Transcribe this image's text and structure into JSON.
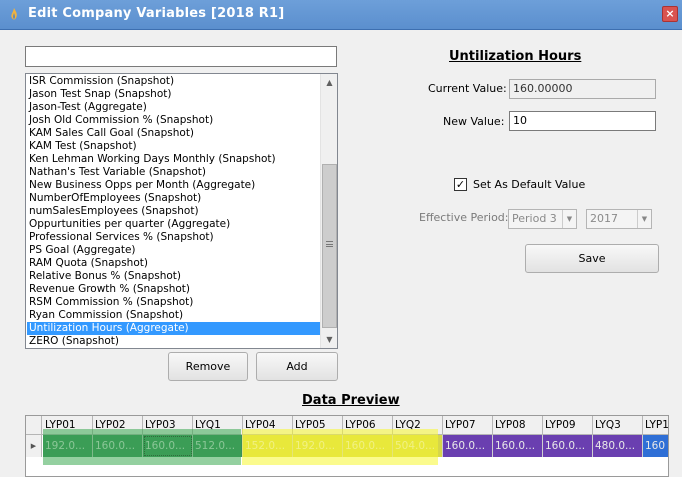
{
  "window": {
    "title": "Edit Company Variables [2018 R1]",
    "close_label": "×"
  },
  "filter": {
    "value": ""
  },
  "list": {
    "items": [
      "ISR Commission (Snapshot)",
      "Jason Test Snap (Snapshot)",
      "Jason-Test (Aggregate)",
      "Josh Old Commission % (Snapshot)",
      "KAM Sales Call Goal (Snapshot)",
      "KAM Test (Snapshot)",
      "Ken Lehman Working Days Monthly (Snapshot)",
      "Nathan's Test Variable (Snapshot)",
      "New Business Opps per Month (Aggregate)",
      "NumberOfEmployees (Snapshot)",
      "numSalesEmployees (Snapshot)",
      "Oppurtunities per quarter (Aggregate)",
      "Professional Services % (Snapshot)",
      "PS Goal (Aggregate)",
      "RAM Quota (Snapshot)",
      "Relative Bonus % (Snapshot)",
      "Revenue Growth % (Snapshot)",
      "RSM Commission % (Snapshot)",
      "Ryan Commission (Snapshot)",
      "Untilization Hours (Aggregate)",
      "ZERO (Snapshot)"
    ],
    "selected_index": 19
  },
  "buttons": {
    "remove": "Remove",
    "add": "Add",
    "save": "Save"
  },
  "detail": {
    "title": "Untilization Hours",
    "current_label": "Current Value:",
    "current_value": "160.00000",
    "new_label": "New Value:",
    "new_value": "10",
    "default_label": "Set As Default Value",
    "default_checked": true,
    "effective_label": "Effective Period:",
    "period": "Period 3",
    "year": "2017"
  },
  "preview": {
    "title": "Data Preview",
    "columns": [
      "LYP01",
      "LYP02",
      "LYP03",
      "LYQ1",
      "LYP04",
      "LYP05",
      "LYP06",
      "LYQ2",
      "LYP07",
      "LYP08",
      "LYP09",
      "LYQ3",
      "LYP1"
    ],
    "cells": [
      "192.0...",
      "160.0...",
      "160.0...",
      "512.0...",
      "152.0...",
      "192.0...",
      "160.0...",
      "504.0...",
      "160.0...",
      "160.0...",
      "160.0...",
      "480.0...",
      "160"
    ],
    "cell_colors": [
      "#3a8f5c",
      "#3a8f5c",
      "#3a8f5c",
      "#3a8f5c",
      "#d6d64a",
      "#d6d64a",
      "#d6d64a",
      "#d6d64a",
      "#6a3fb0",
      "#6a3fb0",
      "#6a3fb0",
      "#6a3fb0",
      "#2f6fd6"
    ],
    "row_marker": "▶"
  },
  "colors": {
    "selection": "#3399ff",
    "highlight_green": "#3daa52",
    "highlight_yellow": "#f7f730"
  }
}
